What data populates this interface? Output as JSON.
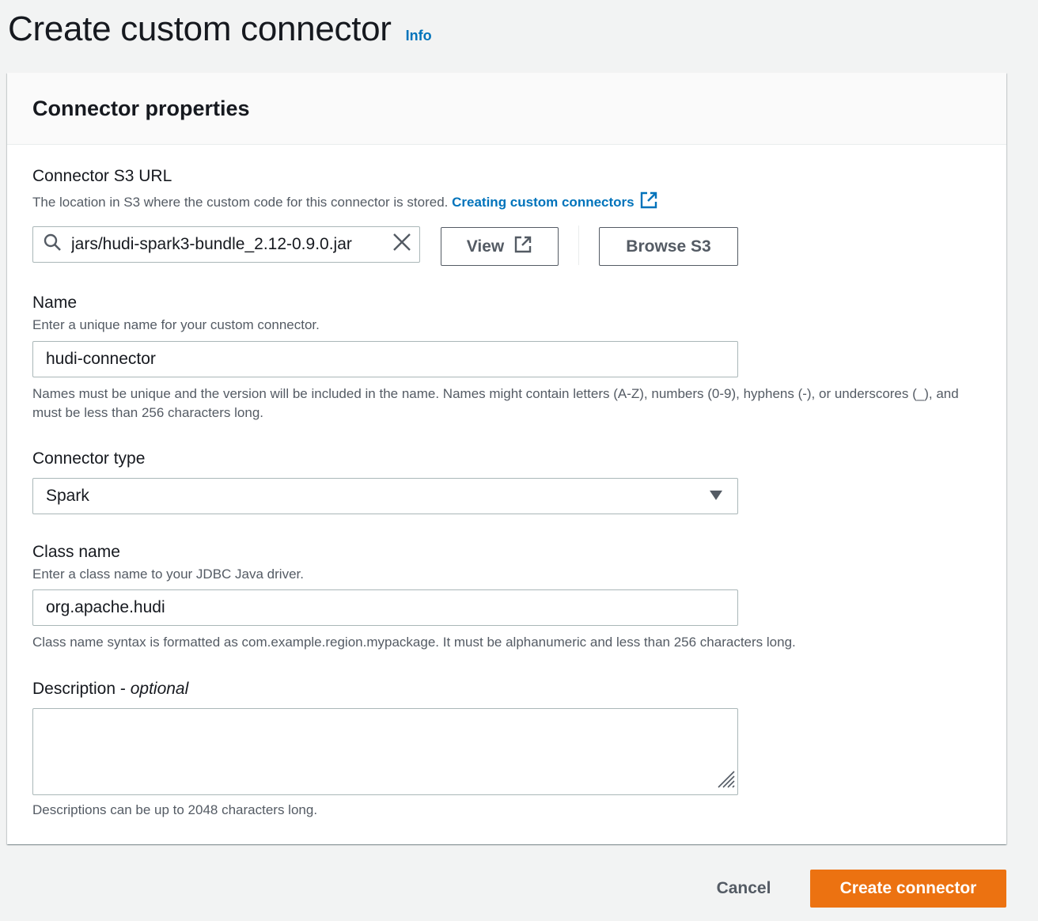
{
  "page": {
    "title": "Create custom connector",
    "info_link": "Info"
  },
  "panel": {
    "title": "Connector properties"
  },
  "s3_url": {
    "label": "Connector S3 URL",
    "description": "The location in S3 where the custom code for this connector is stored.",
    "help_link": "Creating custom connectors",
    "value": "jars/hudi-spark3-bundle_2.12-0.9.0.jar",
    "view_button": "View",
    "browse_button": "Browse S3"
  },
  "name": {
    "label": "Name",
    "description": "Enter a unique name for your custom connector.",
    "value": "hudi-connector",
    "constraint": "Names must be unique and the version will be included in the name. Names might contain letters (A-Z), numbers (0-9), hyphens (-), or underscores (_), and must be less than 256 characters long."
  },
  "connector_type": {
    "label": "Connector type",
    "value": "Spark"
  },
  "class_name": {
    "label": "Class name",
    "description": "Enter a class name to your JDBC Java driver.",
    "value": "org.apache.hudi",
    "constraint": "Class name syntax is formatted as com.example.region.mypackage. It must be alphanumeric and less than 256 characters long."
  },
  "description": {
    "label": "Description",
    "label_suffix": "optional",
    "value": "",
    "constraint": "Descriptions can be up to 2048 characters long."
  },
  "footer": {
    "cancel": "Cancel",
    "submit": "Create connector"
  },
  "colors": {
    "link": "#0073bb",
    "primary": "#ec7211",
    "border": "#aab7b8",
    "text_secondary": "#545b64"
  },
  "icons": {
    "search": "search-icon",
    "clear": "close-icon",
    "external": "external-link-icon",
    "dropdown": "caret-down-icon",
    "resize": "resize-grip-icon"
  }
}
